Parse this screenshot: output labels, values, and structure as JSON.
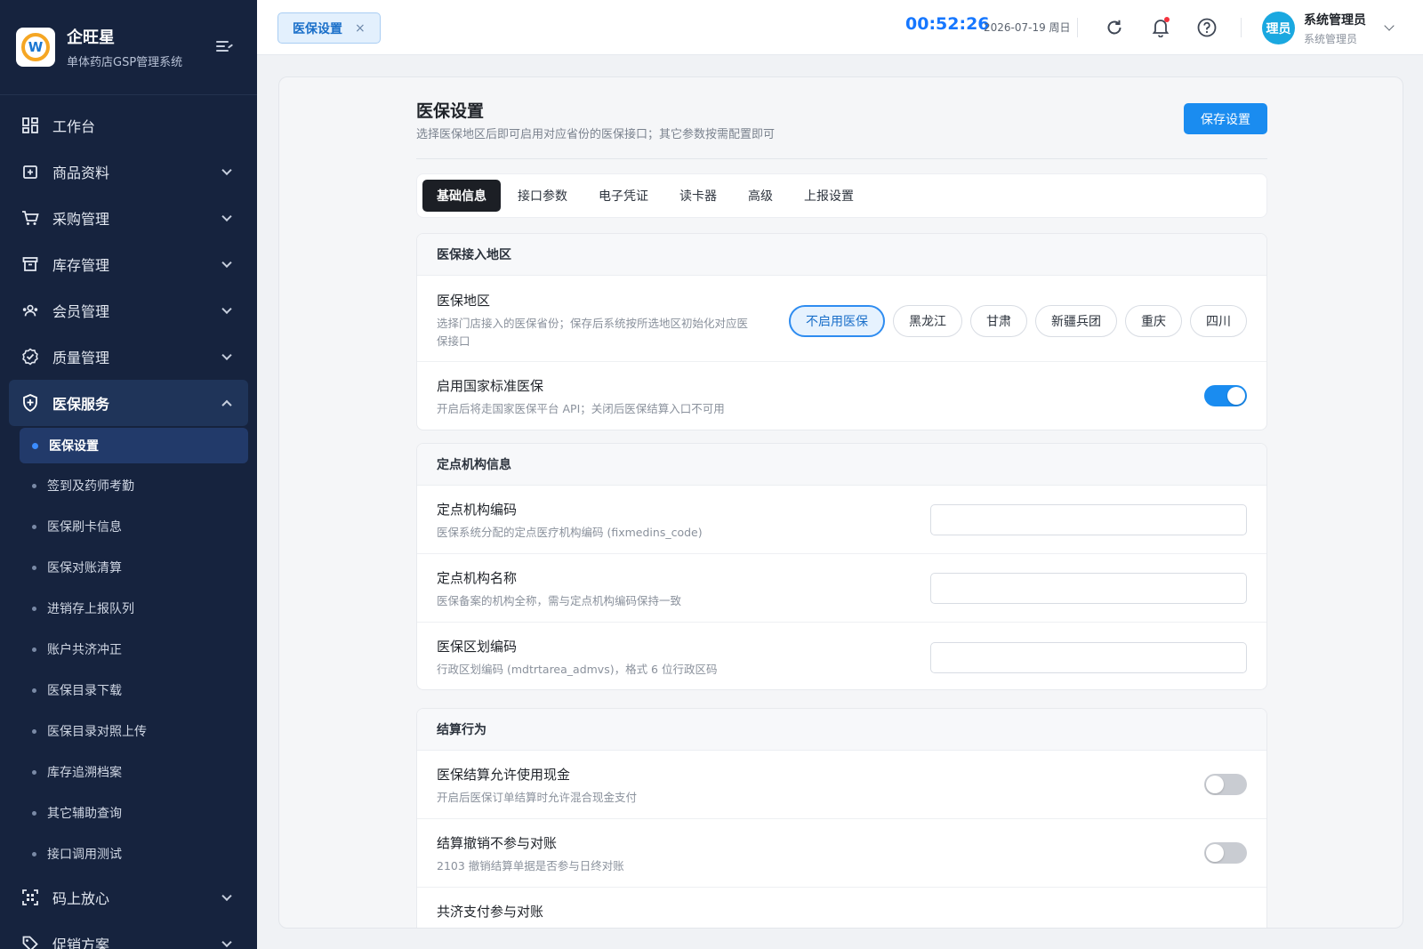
{
  "sidebar": {
    "brand_name": "企旺星",
    "brand_sub": "单体药店GSP管理系统",
    "logo_text": "W",
    "nav": [
      {
        "label": "工作台"
      },
      {
        "label": "商品资料"
      },
      {
        "label": "采购管理"
      },
      {
        "label": "库存管理"
      },
      {
        "label": "会员管理"
      },
      {
        "label": "质量管理"
      },
      {
        "label": "医保服务"
      }
    ],
    "sub": [
      {
        "label": "医保设置"
      },
      {
        "label": "签到及药师考勤"
      },
      {
        "label": "医保刷卡信息"
      },
      {
        "label": "医保对账清算"
      },
      {
        "label": "进销存上报队列"
      },
      {
        "label": "账户共济冲正"
      },
      {
        "label": "医保目录下载"
      },
      {
        "label": "医保目录对照上传"
      },
      {
        "label": "库存追溯档案"
      },
      {
        "label": "其它辅助查询"
      },
      {
        "label": "接口调用测试"
      }
    ],
    "nav_bottom": [
      {
        "label": "码上放心"
      },
      {
        "label": "促销方案"
      }
    ]
  },
  "header": {
    "tab_label": "医保设置",
    "tab_close": "×",
    "clock": "00:52:26",
    "date": "2026-07-19 周日",
    "avatar_text": "理员",
    "user_name": "系统管理员",
    "user_role": "系统管理员"
  },
  "page": {
    "title": "医保设置",
    "subtitle": "选择医保地区后即可启用对应省份的医保接口；其它参数按需配置即可",
    "save_label": "保存设置",
    "tabs": [
      "基础信息",
      "接口参数",
      "电子凭证",
      "读卡器",
      "高级",
      "上报设置"
    ]
  },
  "region_card": {
    "title": "医保接入地区",
    "region_label": "医保地区",
    "region_desc": "选择门店接入的医保省份；保存后系统按所选地区初始化对应医保接口",
    "regions": [
      "不启用医保",
      "黑龙江",
      "甘肃",
      "新疆兵团",
      "重庆",
      "四川"
    ],
    "selected_region": "不启用医保",
    "national_label": "启用国家标准医保",
    "national_desc": "开启后将走国家医保平台 API；关闭后医保结算入口不可用",
    "national_on": true
  },
  "org_card": {
    "title": "定点机构信息",
    "fields": [
      {
        "label": "定点机构编码",
        "desc": "医保系统分配的定点医疗机构编码 (fixmedins_code)",
        "value": ""
      },
      {
        "label": "定点机构名称",
        "desc": "医保备案的机构全称，需与定点机构编码保持一致",
        "value": ""
      },
      {
        "label": "医保区划编码",
        "desc": "行政区划编码 (mdtrtarea_admvs)，格式 6 位行政区码",
        "value": ""
      }
    ]
  },
  "settle_card": {
    "title": "结算行为",
    "rows": [
      {
        "label": "医保结算允许使用现金",
        "desc": "开启后医保订单结算时允许混合现金支付",
        "on": false
      },
      {
        "label": "结算撤销不参与对账",
        "desc": "2103 撤销结算单据是否参与日终对账",
        "on": false
      },
      {
        "label": "共济支付参与对账",
        "desc": "",
        "on": false
      }
    ]
  },
  "colors": {
    "sidebar_bg": "#16233e",
    "accent": "#1a8cf0",
    "active_tab": "#1c1f25"
  }
}
